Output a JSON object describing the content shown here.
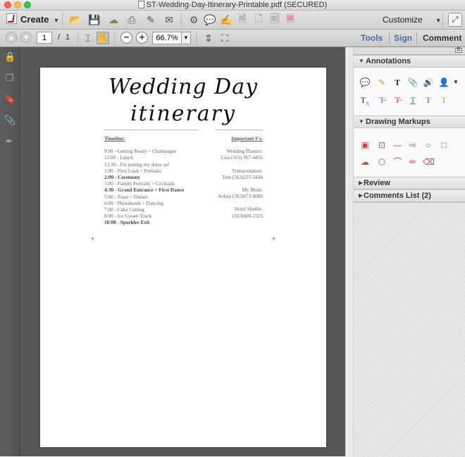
{
  "window": {
    "title": "ST-Wedding-Day-Itinerary-Printable.pdf (SECURED)"
  },
  "toolbar": {
    "create_label": "Create",
    "customize_label": "Customize",
    "icons": [
      "folder-open-icon",
      "save-icon",
      "cloud-upload-icon",
      "print-icon",
      "edit-icon",
      "email-icon",
      "gear-icon",
      "comment-icon",
      "sign-icon",
      "document-icon",
      "document-secure-icon",
      "document-stamp-icon"
    ]
  },
  "nav": {
    "page_current": "1",
    "page_separator": "/",
    "page_total": "1",
    "zoom_value": "66.7%"
  },
  "right_tabs": {
    "tools": "Tools",
    "sign": "Sign",
    "comment": "Comment"
  },
  "document": {
    "title_line1": "Wedding Day",
    "title_line2": "itinerary",
    "timeline_header": "Timeline:",
    "important_header": "Important #'s:",
    "timeline": [
      {
        "text": "9:00 - Getting Ready + Champagne",
        "bold": false
      },
      {
        "text": "12:00 - Lunch",
        "bold": false
      },
      {
        "text": "12:30 - I'm putting my dress on!",
        "bold": false
      },
      {
        "text": "1:00 - First Look + Portraits",
        "bold": false
      },
      {
        "text": "2:00 - Ceremony",
        "bold": true
      },
      {
        "text": "3:00 - Family Portraits + Cocktails",
        "bold": false
      },
      {
        "text": "4:30 - Grand Entrance + First Dance",
        "bold": true
      },
      {
        "text": "5:00 - Toast + Dinner",
        "bold": false
      },
      {
        "text": "6:00 - Photobooth + Dancing",
        "bold": false
      },
      {
        "text": "7:00 - Cake Cutting",
        "bold": false
      },
      {
        "text": "8:00 - Ice Cream Truck",
        "bold": false
      },
      {
        "text": "10:00 - Sparkler Exit",
        "bold": true
      }
    ],
    "contacts": [
      {
        "role": "Wedding Planner:",
        "detail": "Lisa (563) 567-4456"
      },
      {
        "role": "Transportation:",
        "detail": "Tom (563)227-3444"
      },
      {
        "role": "My Mom:",
        "detail": "JoAnn (563)673-9009"
      },
      {
        "role": "Hotel Shuttle:",
        "detail": "(563)600-2323"
      }
    ]
  },
  "panel": {
    "annotations_label": "Annotations",
    "drawing_label": "Drawing Markups",
    "review_label": "Review",
    "comments_label": "Comments List (2)"
  },
  "colors": {
    "tab_blue": "#4a6f9e",
    "markup_red": "#d84040",
    "workspace_gray": "#575757"
  }
}
